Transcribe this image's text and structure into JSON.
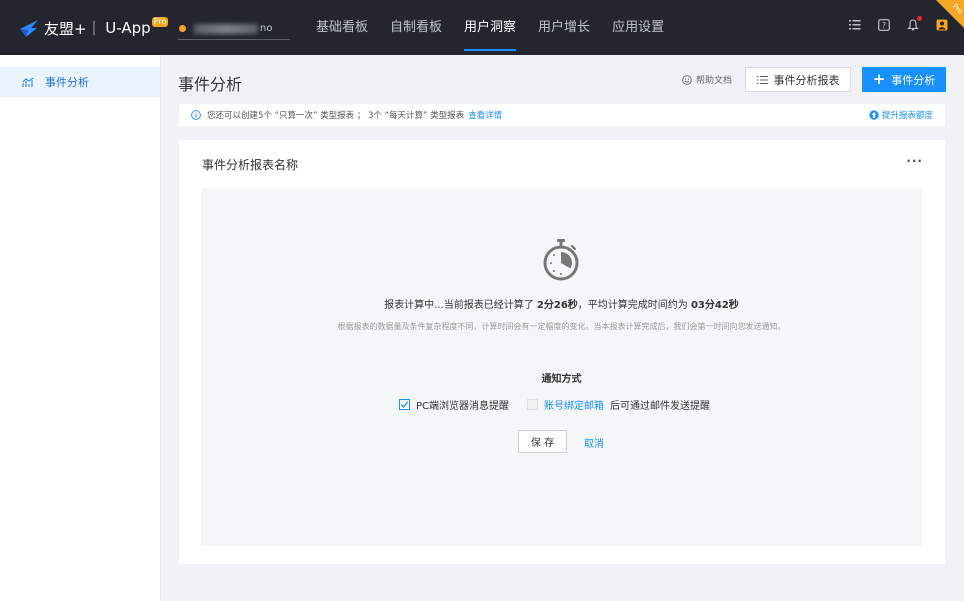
{
  "header": {
    "brand": "友盟+",
    "product": "U-App",
    "pro_tag": "Pro",
    "app_name_suffix": "no",
    "nav": [
      {
        "label": "基础看板"
      },
      {
        "label": "自制看板"
      },
      {
        "label": "用户洞察"
      },
      {
        "label": "用户增长"
      },
      {
        "label": "应用设置"
      }
    ],
    "corner_badge": "Pro",
    "active_nav": "用户洞察"
  },
  "sidebar": {
    "items": [
      {
        "label": "事件分析"
      }
    ]
  },
  "page": {
    "title": "事件分析",
    "help_label": "帮助文档",
    "report_button": "事件分析报表",
    "add_button": "事件分析"
  },
  "notice": {
    "text": "您还可以创建5个 “只算一次” 类型报表 ； 3个 “每天计算” 类型报表",
    "detail_link": "查看详情",
    "upgrade_link": "提升报表额度"
  },
  "card": {
    "title": "事件分析报表名称",
    "more": "···",
    "status_prefix": "报表计算中...当前报表已经计算了",
    "elapsed": "2分26秒",
    "status_mid": "，平均计算完成时间约为",
    "average": "03分42秒",
    "sub_text": "根据报表的数据量及条件复杂程度不同，计算时间会有一定幅度的变化。当本报表计算完成后，我们会第一时间向您发送通知。",
    "notify_title": "通知方式",
    "option_browser": "PC端浏览器消息提醒",
    "option_browser_checked": true,
    "option_email_link": "账号绑定邮箱",
    "option_email_suffix": "后可通过邮件发送提醒",
    "option_email_checked": false,
    "save_button": "保 存",
    "cancel_button": "取消"
  },
  "colors": {
    "topbar": "#23262e",
    "accent": "#1890ff",
    "pro": "#f5a623"
  }
}
